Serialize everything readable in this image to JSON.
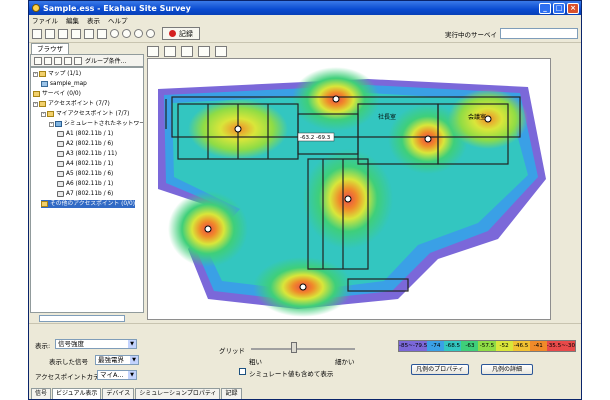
{
  "window": {
    "title": "Sample.ess - Ekahau Site Survey",
    "minimize": "_",
    "maximize": "□",
    "close": "×"
  },
  "menu": [
    "ファイル",
    "編集",
    "表示",
    "ヘルプ"
  ],
  "toolbar": {
    "record_label": "記録",
    "running_survey_label": "実行中のサーベイ",
    "running_survey_value": ""
  },
  "browser": {
    "tab_label": "ブラウザ",
    "group_conditions_label": "グループ条件...",
    "tree": [
      {
        "label": "マップ (1/1)",
        "icon": "folder-icon",
        "level": 0,
        "expand": "-"
      },
      {
        "label": "sample_map",
        "icon": "map-icon",
        "level": 1,
        "expand": ""
      },
      {
        "label": "サーベイ (0/0)",
        "icon": "folder-icon",
        "level": 0,
        "expand": ""
      },
      {
        "label": "アクセスポイント (7/7)",
        "icon": "folder-icon",
        "level": 0,
        "expand": "-"
      },
      {
        "label": "マイアクセスポイント (7/7)",
        "icon": "folder-icon",
        "level": 1,
        "expand": "-"
      },
      {
        "label": "シミュレートされたネットワー...",
        "icon": "network-icon",
        "level": 2,
        "expand": "-"
      },
      {
        "label": "A1 (802.11b / 1)",
        "icon": "access-point-icon",
        "level": 3,
        "expand": ""
      },
      {
        "label": "A2 (802.11b / 6)",
        "icon": "access-point-icon",
        "level": 3,
        "expand": ""
      },
      {
        "label": "A3 (802.11b / 11)",
        "icon": "access-point-icon",
        "level": 3,
        "expand": ""
      },
      {
        "label": "A4 (802.11b / 1)",
        "icon": "access-point-icon",
        "level": 3,
        "expand": ""
      },
      {
        "label": "A5 (802.11b / 6)",
        "icon": "access-point-icon",
        "level": 3,
        "expand": ""
      },
      {
        "label": "A6 (802.11b / 1)",
        "icon": "access-point-icon",
        "level": 3,
        "expand": ""
      },
      {
        "label": "A7 (802.11b / 6)",
        "icon": "access-point-icon",
        "level": 3,
        "expand": ""
      },
      {
        "label": "その他のアクセスポイント (0/0)",
        "icon": "folder-icon",
        "level": 1,
        "expand": "",
        "selected": true
      }
    ]
  },
  "map": {
    "name": "sample_map",
    "tooltip": "-63.2  -69.3",
    "room_labels": [
      "社長室",
      "会議室"
    ]
  },
  "bottom": {
    "display_label": "表示:",
    "display_value": "信号強度",
    "signal_label": "表示した信号",
    "signal_value": "最強電界",
    "ap_category_label": "アクセスポイントカテゴリ",
    "ap_category_value": "マイA...",
    "grid_label": "グリッド",
    "grid_coarse": "粗い",
    "grid_fine": "細かい",
    "include_sim_label": "シミュレート値も含めて表示",
    "include_sim_checked": false,
    "legend_properties_button": "凡例のプロパティ",
    "legend_details_button": "凡例の詳細",
    "legend": [
      {
        "label": "-85~-79.5",
        "color": "#7b68d9"
      },
      {
        "label": "-74",
        "color": "#3aa0e6"
      },
      {
        "label": "-68.5",
        "color": "#33c6c0"
      },
      {
        "label": "-63",
        "color": "#3fcf7a"
      },
      {
        "label": "-57.5",
        "color": "#8fdc45"
      },
      {
        "label": "-52",
        "color": "#d9e63a"
      },
      {
        "label": "-46.5",
        "color": "#f2c233"
      },
      {
        "label": "-41",
        "color": "#f08a2a"
      },
      {
        "label": "-35.5~-30",
        "color": "#e84a4a"
      }
    ]
  },
  "bottom_tabs": [
    "信号",
    "ビジュアル表示",
    "デバイス",
    "シミュレーションプロパティ",
    "記録"
  ],
  "active_bottom_tab": "ビジュアル表示"
}
